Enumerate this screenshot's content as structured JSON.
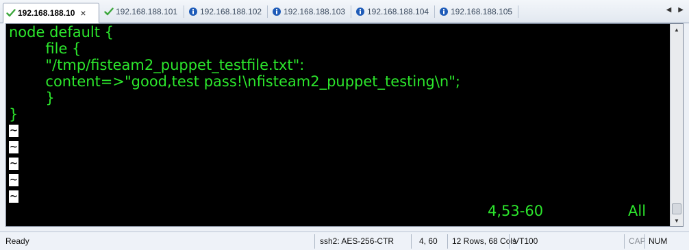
{
  "tabs": [
    {
      "label": "192.168.188.10",
      "status": "connected",
      "active": true
    },
    {
      "label": "192.168.188.101",
      "status": "connected",
      "active": false
    },
    {
      "label": "192.168.188.102",
      "status": "info",
      "active": false
    },
    {
      "label": "192.168.188.103",
      "status": "info",
      "active": false
    },
    {
      "label": "192.168.188.104",
      "status": "info",
      "active": false
    },
    {
      "label": "192.168.188.105",
      "status": "info",
      "active": false
    }
  ],
  "tab_close_symbol": "×",
  "terminal": {
    "lines": [
      "node default {",
      "        file {",
      "        \"/tmp/fisteam2_puppet_testfile.txt\":",
      "        content=>\"good,test pass!\\nfisteam2_puppet_testing\\n\";",
      "        }",
      "}"
    ],
    "tilde": "~",
    "cursor_position": "4,53-60",
    "scroll_indicator": "All"
  },
  "statusbar": {
    "ready": "Ready",
    "cipher": "ssh2: AES-256-CTR",
    "position": "4,  60",
    "size": "12 Rows, 68 Cols",
    "emulation": "VT100",
    "cap": "CAP",
    "num": "NUM"
  },
  "colors": {
    "terminal_fg": "#2ce62c",
    "terminal_bg": "#000000",
    "check_green": "#3aa63a",
    "info_blue": "#1e5bb8"
  }
}
